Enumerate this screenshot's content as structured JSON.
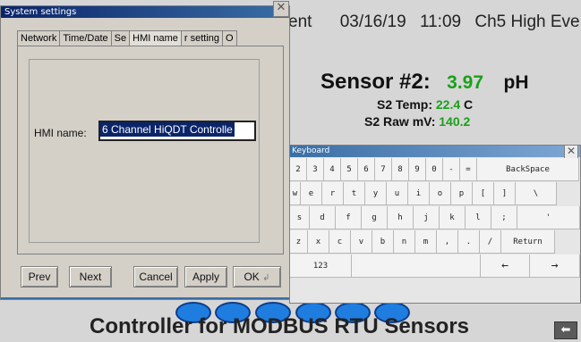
{
  "hmi": {
    "header_partial": "ent",
    "date": "03/16/19",
    "time": "11:09",
    "alarm": "Ch5 High Eve",
    "sensor2": {
      "title": "Sensor #2:",
      "value": "3.97",
      "unit": "pH",
      "temp_label": "S2 Temp:",
      "temp_value": "22.4",
      "temp_unit": "C",
      "raw_label": "S2 Raw mV:",
      "raw_value": "140.2"
    },
    "footer": "Controller for MODBUS RTU Sensors",
    "back_icon": "arrow-left-icon"
  },
  "settings": {
    "title": "System settings",
    "tabs": [
      "Network",
      "Time/Date",
      "Se",
      "HMI name",
      "r setting",
      "O"
    ],
    "hmi_name_label": "HMI name:",
    "hmi_name_value": "6 Channel HiQDT Controlle",
    "buttons": {
      "prev": "Prev",
      "next": "Next",
      "cancel": "Cancel",
      "apply": "Apply",
      "ok": "OK"
    }
  },
  "keyboard": {
    "title": "Keyboard",
    "rows": [
      [
        "2",
        "3",
        "4",
        "5",
        "6",
        "7",
        "8",
        "9",
        "0",
        "-",
        "=",
        "BackSpace"
      ],
      [
        "w",
        "e",
        "r",
        "t",
        "y",
        "u",
        "i",
        "o",
        "p",
        "[",
        "]",
        "\\"
      ],
      [
        "s",
        "d",
        "f",
        "g",
        "h",
        "j",
        "k",
        "l",
        ";",
        "'"
      ],
      [
        "z",
        "x",
        "c",
        "v",
        "b",
        "n",
        "m",
        ",",
        ".",
        "/",
        "Return"
      ],
      [
        "123",
        "",
        "←",
        "→"
      ]
    ]
  }
}
